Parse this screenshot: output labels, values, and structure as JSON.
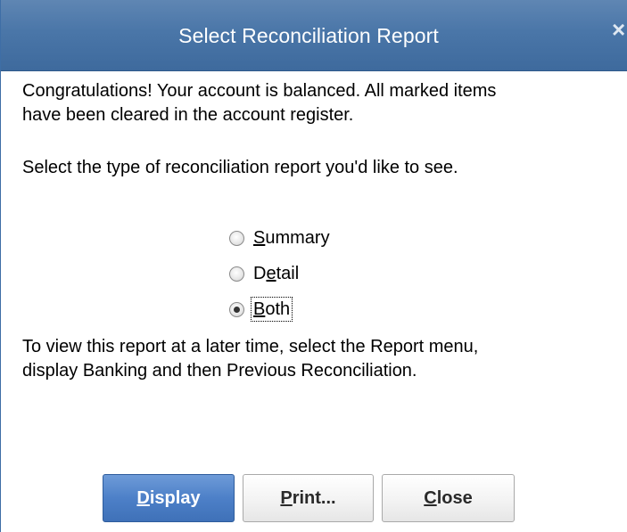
{
  "dialog": {
    "title": "Select Reconciliation Report",
    "close_glyph": "×"
  },
  "message": {
    "congrats_line1": "Congratulations! Your account is balanced. All marked items",
    "congrats_line2": "have been cleared in the account register.",
    "select_prompt": "Select the type of reconciliation report you'd like to see.",
    "later_line1": "To view this report at a later time, select the Report menu,",
    "later_line2": "display Banking and then Previous Reconciliation."
  },
  "report_type": {
    "selected": "Both",
    "options": [
      {
        "key": "S",
        "rest": "ummary",
        "label": "Summary",
        "checked": false
      },
      {
        "pre": "D",
        "key": "e",
        "rest": "tail",
        "label": "Detail",
        "checked": false
      },
      {
        "key": "B",
        "rest": "oth",
        "label": "Both",
        "checked": true
      }
    ]
  },
  "buttons": {
    "display": {
      "key": "D",
      "rest": "isplay"
    },
    "print": {
      "key": "P",
      "rest": "rint..."
    },
    "close": {
      "key": "C",
      "rest": "lose"
    }
  },
  "colors": {
    "titlebar": "#4a76a8",
    "primary_button": "#4d80c8"
  },
  "icons": {
    "close": "close-icon",
    "radio": "radio-button"
  }
}
